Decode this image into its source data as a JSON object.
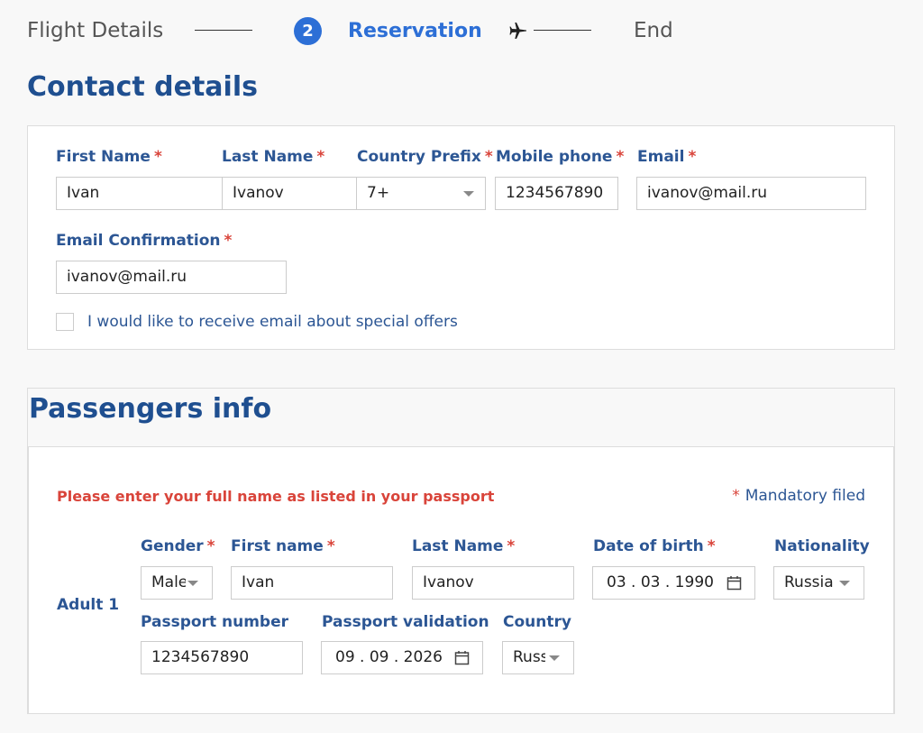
{
  "stepper": {
    "step1": "Flight Details",
    "step2_number": "2",
    "step2": "Reservation",
    "step3": "End",
    "plane_icon": "airplane-icon"
  },
  "contact": {
    "title": "Contact details",
    "required_mark": "*",
    "first_name": {
      "label": "First Name",
      "value": "Ivan"
    },
    "last_name": {
      "label": "Last Name",
      "value": "Ivanov"
    },
    "country_prefix": {
      "label": "Country Prefix",
      "value": "7+"
    },
    "mobile_phone": {
      "label": "Mobile phone",
      "value": "1234567890"
    },
    "email": {
      "label": "Email",
      "value": "ivanov@mail.ru"
    },
    "email_confirmation": {
      "label": "Email Confirmation",
      "value": "ivanov@mail.ru"
    },
    "offers_checkbox": {
      "label": "I would like to receive email about special offers",
      "checked": false
    }
  },
  "passengers": {
    "title": "Passengers info",
    "warning": "Please enter your full name as listed in your passport",
    "mandatory_mark": "*",
    "mandatory_note": "Mandatory filed",
    "adult_label": "Adult 1",
    "gender": {
      "label": "Gender",
      "value": "Male"
    },
    "first_name": {
      "label": "First name",
      "value": "Ivan"
    },
    "last_name": {
      "label": "Last Name",
      "value": "Ivanov"
    },
    "date_of_birth": {
      "label": "Date of birth",
      "value": "03 . 03 . 1990"
    },
    "nationality": {
      "label": "Nationality",
      "value": "Russia"
    },
    "passport_number": {
      "label": "Passport number",
      "value": "1234567890"
    },
    "passport_validation": {
      "label": "Passport validation",
      "value": "09 . 09 . 2026"
    },
    "country": {
      "label": "Country",
      "value": "Russia"
    }
  },
  "colors": {
    "accent": "#2d6fd6",
    "label": "#2c5694",
    "heading": "#1f4f90",
    "required": "#d9443a"
  }
}
